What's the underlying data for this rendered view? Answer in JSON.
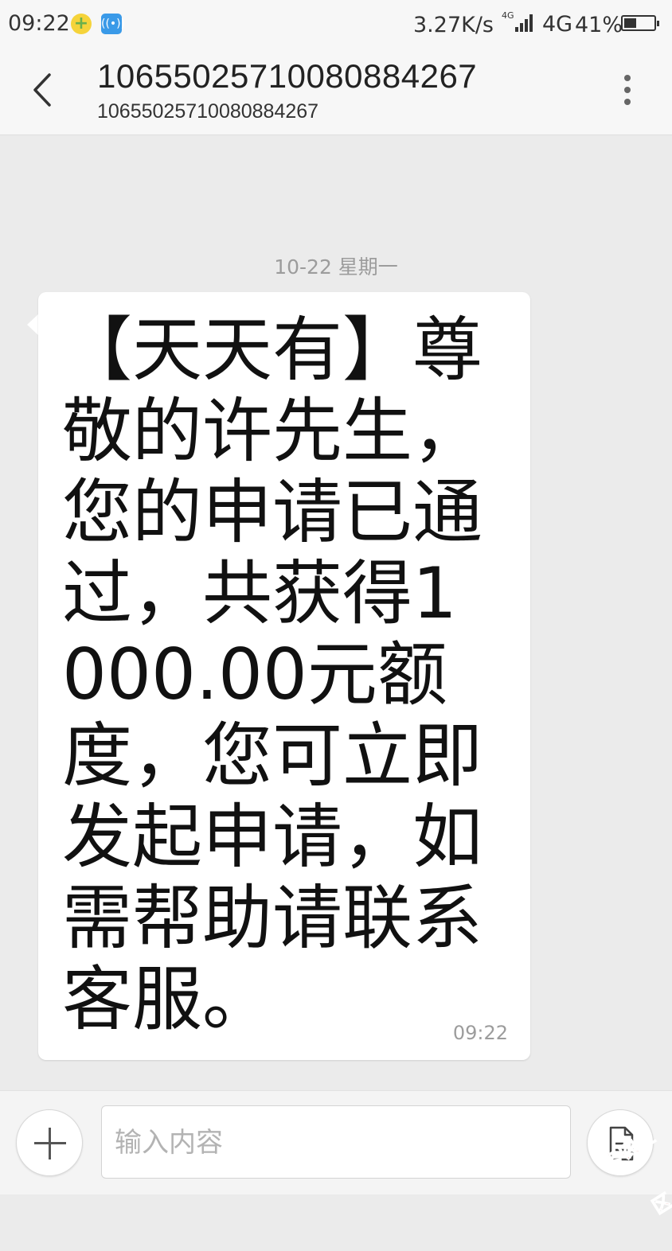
{
  "status_bar": {
    "time": "09:22",
    "speed": "3.27K/s",
    "network_small": "4G",
    "network": "4G",
    "battery": "41%",
    "battery_level": 0.41,
    "icons": [
      "plus-circle-icon",
      "wifi-hotspot-icon",
      "signal-bars-icon",
      "battery-icon"
    ]
  },
  "header": {
    "title": "10655025710080884267",
    "subtitle": "10655025710080884267"
  },
  "conversation": {
    "date_separator": "10-22  星期一",
    "messages": [
      {
        "text": "【天天有】尊敬的许先生，您的申请已通过，共获得1000.00元额度，您可立即发起申请，如需帮助请联系客服。",
        "time": "09:22",
        "direction": "incoming"
      }
    ]
  },
  "composer": {
    "placeholder": "输入内容",
    "value": ""
  },
  "watermark": {
    "text": "卡农社区",
    "color": "#d32020"
  }
}
